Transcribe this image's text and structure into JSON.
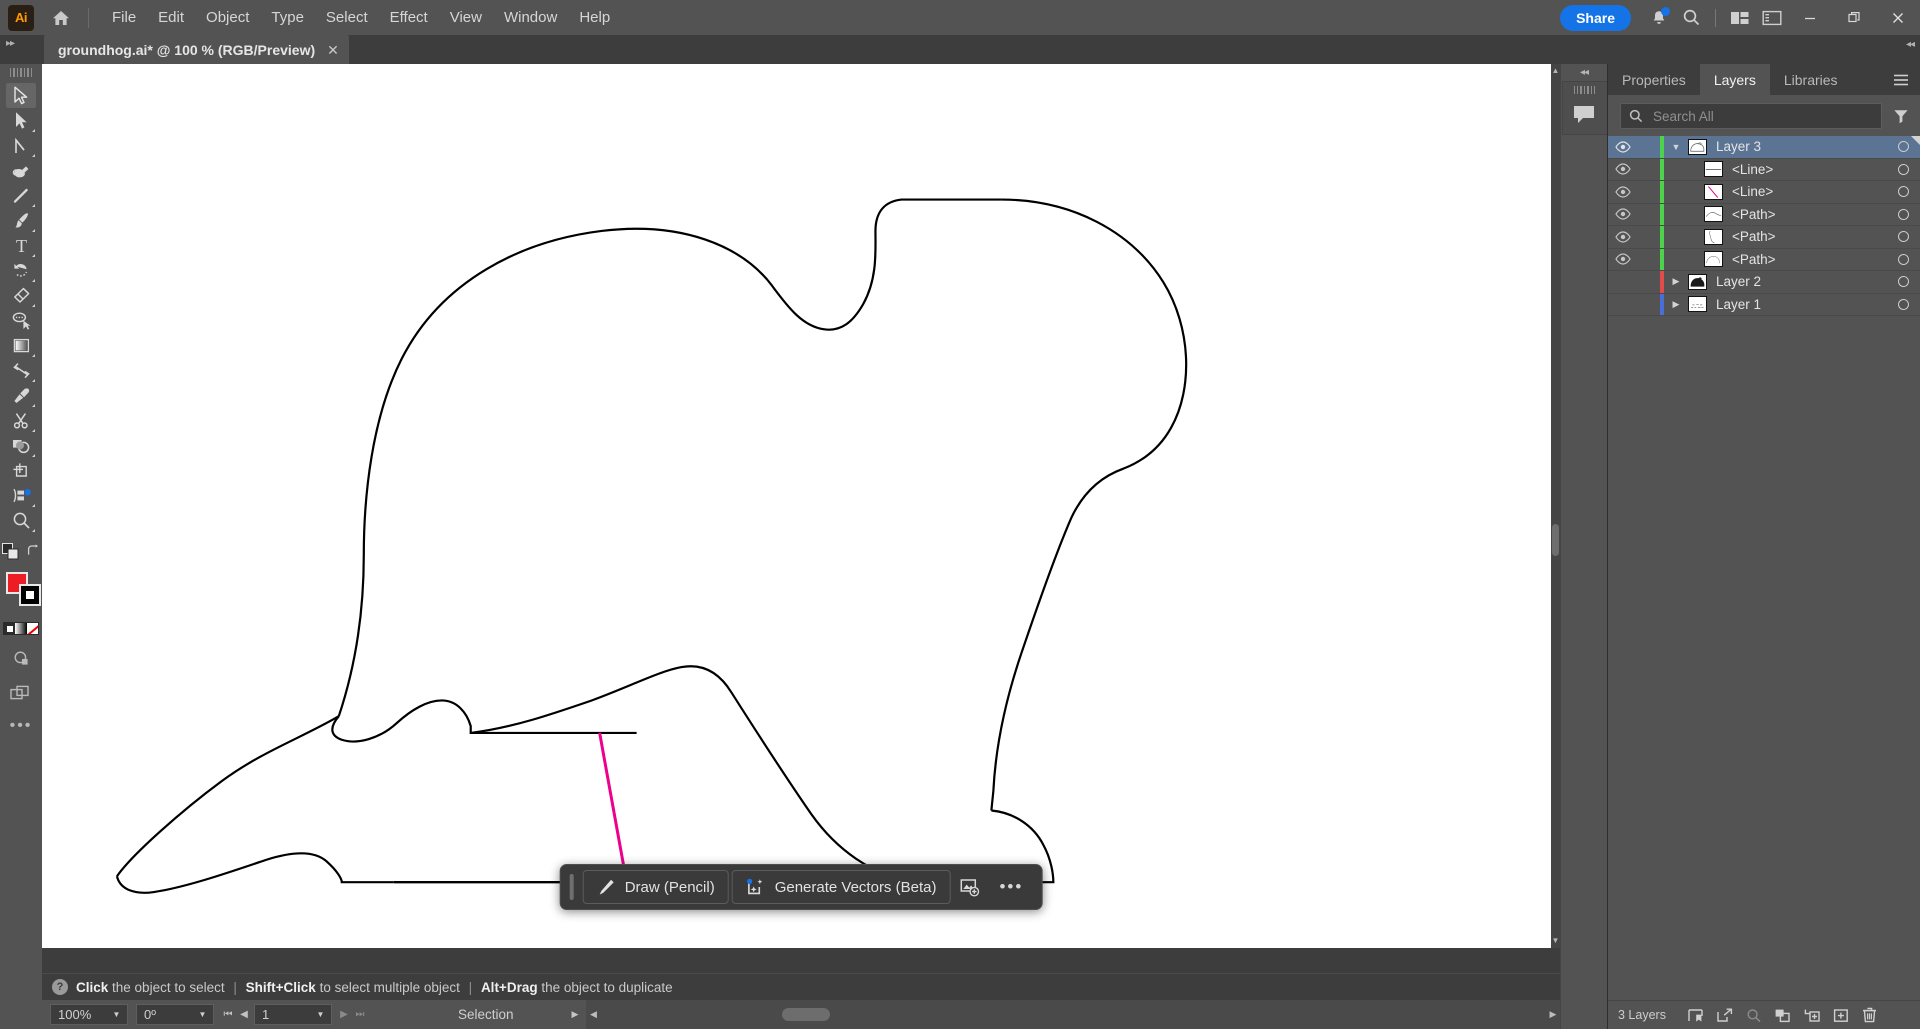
{
  "app": {
    "logo_text": "Ai",
    "menu": [
      "File",
      "Edit",
      "Object",
      "Type",
      "Select",
      "Effect",
      "View",
      "Window",
      "Help"
    ],
    "share_label": "Share"
  },
  "tab": {
    "title": "groundhog.ai* @ 100 % (RGB/Preview)",
    "close_label": "✕"
  },
  "toolbar": {
    "tools": [
      {
        "name": "selection-tool",
        "label": "Selection",
        "active": true,
        "corner": false
      },
      {
        "name": "direct-selection-tool",
        "label": "Direct Selection",
        "active": false,
        "corner": true
      },
      {
        "name": "pen-tool",
        "label": "Pen",
        "active": false,
        "corner": true
      },
      {
        "name": "curvature-tool",
        "label": "Curvature",
        "active": false,
        "corner": false
      },
      {
        "name": "line-segment-tool",
        "label": "Line Segment",
        "active": false,
        "corner": true
      },
      {
        "name": "paintbrush-tool",
        "label": "Paintbrush",
        "active": false,
        "corner": true
      },
      {
        "name": "type-tool",
        "label": "Type",
        "active": false,
        "corner": true
      },
      {
        "name": "rotate-tool",
        "label": "Rotate",
        "active": false,
        "corner": true
      },
      {
        "name": "eraser-tool",
        "label": "Eraser",
        "active": false,
        "corner": true
      },
      {
        "name": "lasso-tool",
        "label": "Lasso",
        "active": false,
        "corner": false
      },
      {
        "name": "gradient-tool",
        "label": "Gradient",
        "active": false,
        "corner": true
      },
      {
        "name": "width-tool",
        "label": "Width",
        "active": false,
        "corner": true
      },
      {
        "name": "eyedropper-tool",
        "label": "Eyedropper",
        "active": false,
        "corner": true
      },
      {
        "name": "scissors-tool",
        "label": "Scissors",
        "active": false,
        "corner": true
      },
      {
        "name": "shape-builder-tool",
        "label": "Shape Builder",
        "active": false,
        "corner": true
      },
      {
        "name": "artboard-tool",
        "label": "Artboard",
        "active": false,
        "corner": false
      },
      {
        "name": "perspective-grid-tool",
        "label": "Perspective Grid",
        "active": false,
        "corner": true
      },
      {
        "name": "zoom-tool",
        "label": "Zoom",
        "active": false,
        "corner": true
      }
    ],
    "fill_color": "#ee1c25",
    "stroke_color": "#000000",
    "more_tools_label": "•••"
  },
  "canvas": {
    "artwork_name": "groundhog-outline",
    "stroke_color": "#000000",
    "highlight_stroke_color": "#ec008c",
    "background": "#ffffff"
  },
  "contextual_toolbar": {
    "draw_label": "Draw (Pencil)",
    "generate_label": "Generate Vectors (Beta)",
    "more_label": "•••"
  },
  "hintbar": {
    "segments": [
      {
        "bold": "Click",
        "rest": " the object to select"
      },
      {
        "bold": "Shift+Click",
        "rest": " to select multiple object"
      },
      {
        "bold": "Alt+Drag",
        "rest": " the object to duplicate"
      }
    ],
    "separator": "|"
  },
  "statusbar": {
    "zoom_value": "100%",
    "rotation_value": "0º",
    "artboard_number": "1",
    "mode_label": "Selection"
  },
  "comment_rail": {
    "icon": "comment-icon"
  },
  "right_panel": {
    "tabs": [
      {
        "label": "Properties",
        "active": false
      },
      {
        "label": "Layers",
        "active": true
      },
      {
        "label": "Libraries",
        "active": false
      }
    ],
    "search_placeholder": "Search All",
    "search_value": "",
    "layers": [
      {
        "name": "Layer 3",
        "indent": 0,
        "color": "#4dd24d",
        "visible": true,
        "expanded": true,
        "has_disclosure": true,
        "selected": true,
        "thumb": "groundhog-filled",
        "type": "layer"
      },
      {
        "name": "<Line>",
        "indent": 2,
        "color": "#4dd24d",
        "visible": true,
        "expanded": false,
        "has_disclosure": false,
        "selected": false,
        "thumb": "horizontal-line",
        "type": "object"
      },
      {
        "name": "<Line>",
        "indent": 2,
        "color": "#4dd24d",
        "visible": true,
        "expanded": false,
        "has_disclosure": false,
        "selected": false,
        "thumb": "magenta-diagonal-line",
        "type": "object"
      },
      {
        "name": "<Path>",
        "indent": 2,
        "color": "#4dd24d",
        "visible": true,
        "expanded": false,
        "has_disclosure": false,
        "selected": false,
        "thumb": "curve-path-top",
        "type": "object"
      },
      {
        "name": "<Path>",
        "indent": 2,
        "color": "#4dd24d",
        "visible": true,
        "expanded": false,
        "has_disclosure": false,
        "selected": false,
        "thumb": "leg-path",
        "type": "object"
      },
      {
        "name": "<Path>",
        "indent": 2,
        "color": "#4dd24d",
        "visible": true,
        "expanded": false,
        "has_disclosure": false,
        "selected": false,
        "thumb": "body-path",
        "type": "object"
      },
      {
        "name": "Layer 2",
        "indent": 0,
        "color": "#e04b4b",
        "visible": false,
        "expanded": false,
        "has_disclosure": true,
        "selected": false,
        "thumb": "groundhog-solid",
        "type": "layer"
      },
      {
        "name": "Layer 1",
        "indent": 0,
        "color": "#4a6fd4",
        "visible": false,
        "expanded": false,
        "has_disclosure": true,
        "selected": false,
        "thumb": "dotted-sketch",
        "type": "layer"
      }
    ],
    "footer": {
      "count_label": "3 Layers",
      "buttons": [
        {
          "name": "locate-object-button",
          "dim": false
        },
        {
          "name": "release-to-layers-button",
          "dim": false
        },
        {
          "name": "search-layers-button",
          "dim": true
        },
        {
          "name": "collect-in-new-layer-button",
          "dim": false
        },
        {
          "name": "create-new-sublayer-button",
          "dim": false
        },
        {
          "name": "create-new-layer-button",
          "dim": false
        },
        {
          "name": "delete-selection-button",
          "dim": false
        }
      ]
    }
  }
}
